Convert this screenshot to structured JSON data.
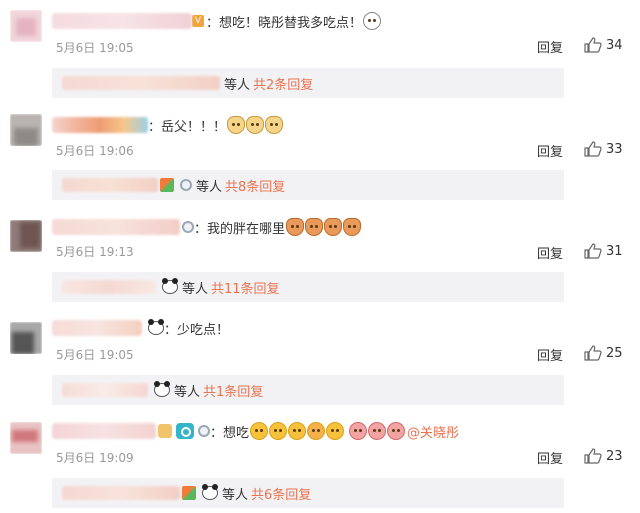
{
  "comments": [
    {
      "text": "：想吃！晓彤替我多吃点！",
      "time": "5月6日 19:05",
      "reply_label": "回复",
      "likes": "34",
      "sub_reply_prefix": "等人",
      "sub_reply_more": "共2条回复"
    },
    {
      "text": "：岳父！！！",
      "time": "5月6日 19:06",
      "reply_label": "回复",
      "likes": "33",
      "sub_reply_prefix": "等人",
      "sub_reply_more": "共8条回复"
    },
    {
      "text": "：我的胖在哪里",
      "time": "5月6日 19:13",
      "reply_label": "回复",
      "likes": "31",
      "sub_reply_prefix": "等人",
      "sub_reply_more": "共11条回复"
    },
    {
      "text": "：少吃点！",
      "time": "5月6日 19:05",
      "reply_label": "回复",
      "likes": "25",
      "sub_reply_prefix": "等人",
      "sub_reply_more": "共1条回复"
    },
    {
      "text": "：想吃",
      "mention": "@关晓彤",
      "time": "5月6日 19:09",
      "reply_label": "回复",
      "likes": "23",
      "sub_reply_prefix": "等人",
      "sub_reply_more": "共6条回复"
    }
  ],
  "colors": {
    "accent": "#eb7350",
    "meta": "#999999",
    "reply_bar_bg": "#f2f2f5"
  },
  "icons": [
    "thumbs-up-icon",
    "emoji-icon",
    "vip-badge-icon",
    "ring-badge-icon",
    "panda-icon",
    "camera-icon",
    "flag-icon"
  ]
}
